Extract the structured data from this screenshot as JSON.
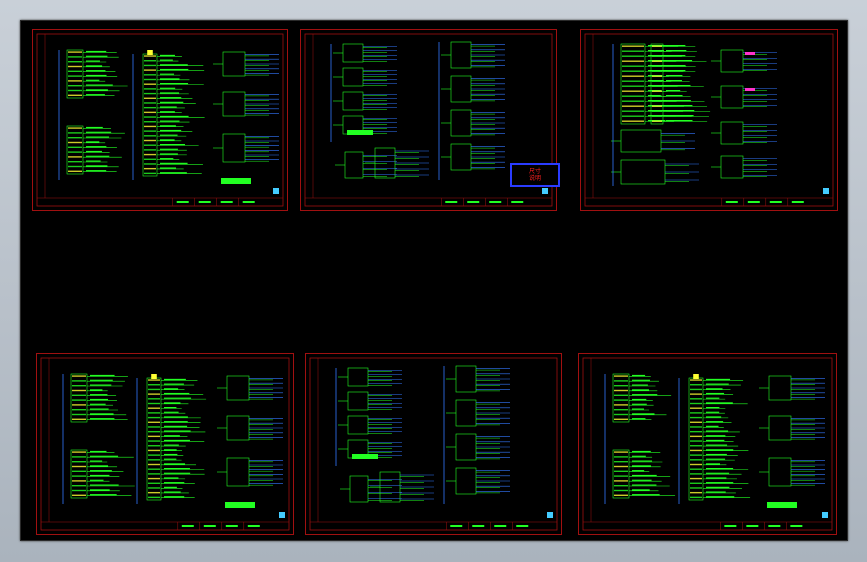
{
  "canvas": {
    "background": "#000000",
    "colors": {
      "frame": "#a01010",
      "wire_green": "#22ff22",
      "wire_blue": "#3377ff",
      "module_yellow": "#ffff33",
      "note_border": "#2a3cff",
      "note_text": "#ff2020",
      "highlight_magenta": "#ff33cc"
    }
  },
  "sheets": [
    {
      "id": "sheet-1",
      "variant": "dual-block"
    },
    {
      "id": "sheet-2",
      "variant": "distributed"
    },
    {
      "id": "sheet-3",
      "variant": "magenta-groups"
    },
    {
      "id": "sheet-4",
      "variant": "dual-block"
    },
    {
      "id": "sheet-5",
      "variant": "distributed"
    },
    {
      "id": "sheet-6",
      "variant": "dual-block"
    }
  ],
  "note": {
    "label": "尺寸\n说明"
  }
}
